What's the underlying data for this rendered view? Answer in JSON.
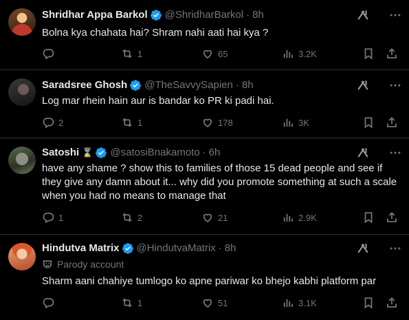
{
  "tweets": [
    {
      "name": "Shridhar Appa Barkol",
      "handle": "@ShridharBarkol",
      "dot": "·",
      "time": "8h",
      "text": "Bolna kya chahata hai? Shram nahi aati hai kya ?",
      "replies": "",
      "retweets": "1",
      "likes": "65",
      "views": "3.2K"
    },
    {
      "name": "Saradsree Ghosh",
      "handle": "@TheSavvySapien",
      "dot": "·",
      "time": "8h",
      "text": "Log mar rhein hain aur is bandar ko PR ki padi hai.",
      "replies": "2",
      "retweets": "1",
      "likes": "178",
      "views": "3K"
    },
    {
      "name": "Satoshi",
      "name_emoji": "⌛",
      "handle": "@satosiBnakamoto",
      "dot": "·",
      "time": "6h",
      "text": "have any shame ? show this to families of those 15 dead people and see if they give any damn about it... why did you promote something at such a scale when you had no means to manage that",
      "replies": "1",
      "retweets": "2",
      "likes": "21",
      "views": "2.9K"
    },
    {
      "name": "Hindutva Matrix",
      "handle": "@HindutvaMatrix",
      "dot": "·",
      "time": "8h",
      "parody_label": "Parody account",
      "text": "Sharm aani chahiye tumlogo ko apne pariwar ko bhejo kabhi platform par",
      "replies": "",
      "retweets": "1",
      "likes": "51",
      "views": "3.1K"
    }
  ],
  "colors": {
    "background": "#000000",
    "text": "#e7e9ea",
    "muted": "#71767b",
    "verified": "#1d9bf0",
    "separator": "#2f3336"
  },
  "icons": [
    "verified-badge-icon",
    "grok-icon",
    "more-icon",
    "reply-icon",
    "retweet-icon",
    "like-icon",
    "views-icon",
    "bookmark-icon",
    "share-icon",
    "parody-mask-icon"
  ]
}
